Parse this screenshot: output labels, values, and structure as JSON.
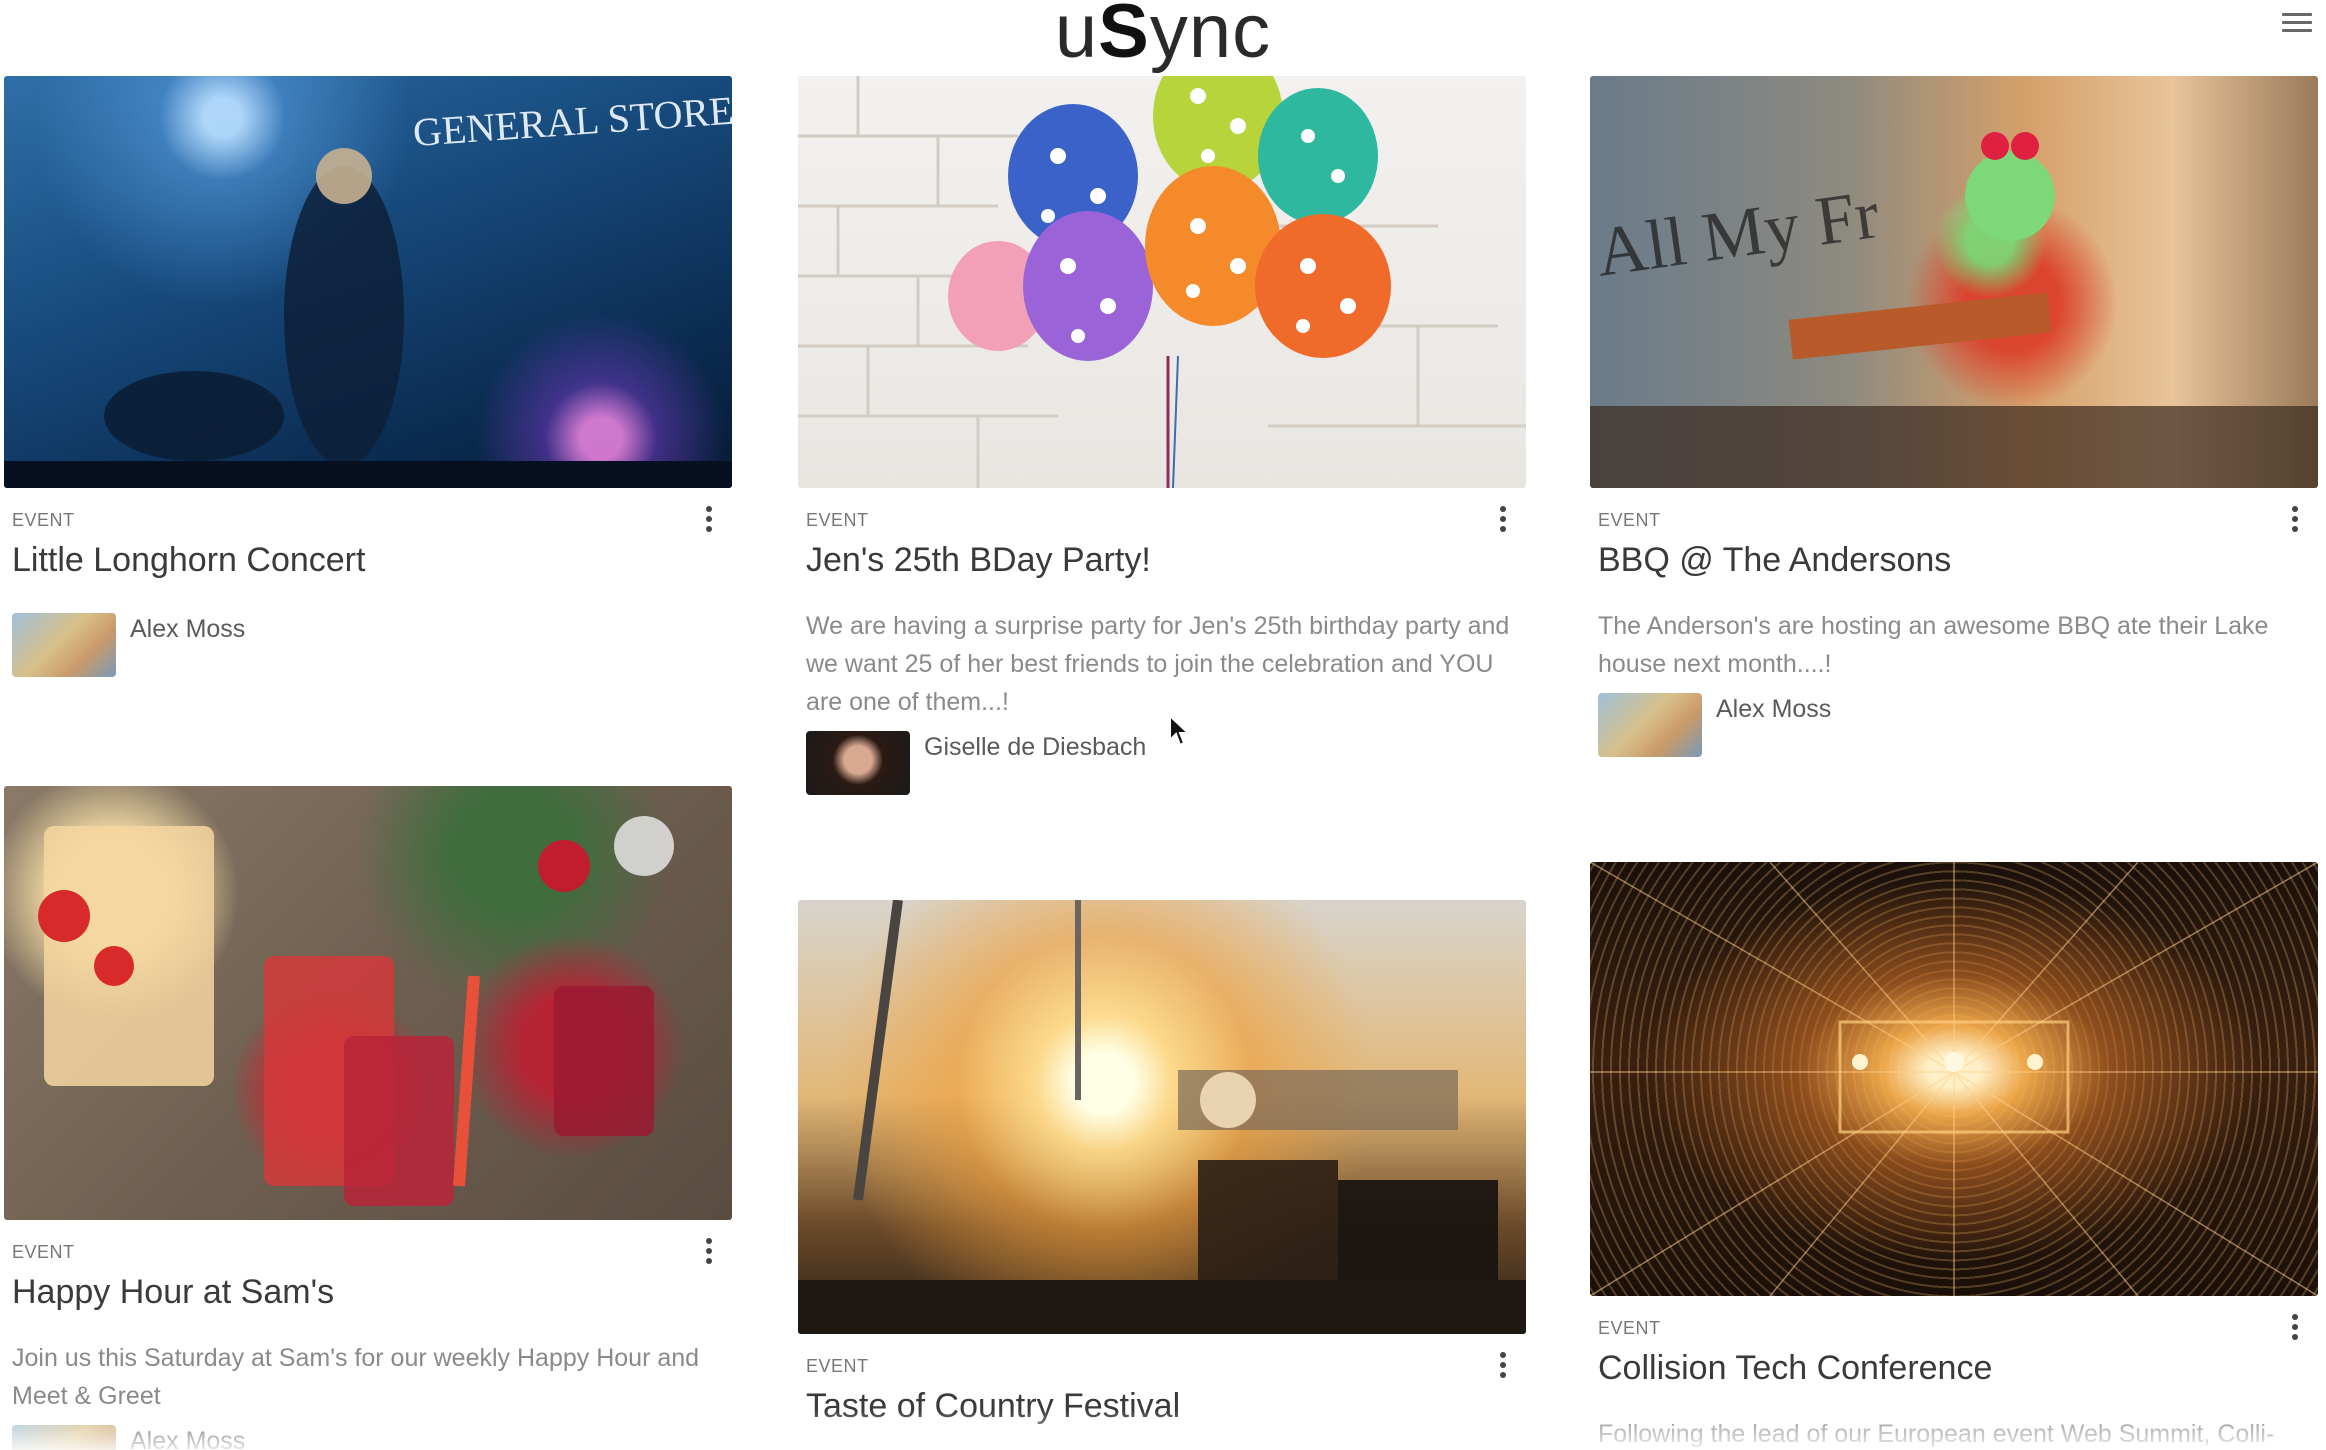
{
  "app": {
    "logo_prefix": "u",
    "logo_big": "S",
    "logo_suffix": "ync",
    "menu_icon": "hamburger-menu-icon"
  },
  "cards": [
    {
      "type": "EVENT",
      "title": "Little Longhorn Concert",
      "description": "",
      "author": "Alex Moss",
      "image": "concert-photo"
    },
    {
      "type": "EVENT",
      "title": "Jen's 25th BDay Party!",
      "description": "We are having a surprise party for Jen's 25th birthday party and we want 25 of her best friends to join the celebration and YOU are one of them...!",
      "author": "Giselle de Diesbach",
      "image": "balloons-photo"
    },
    {
      "type": "EVENT",
      "title": "BBQ @ The Andersons",
      "description": "The Anderson's are hosting an awesome BBQ ate their Lake house next month....!",
      "author": "Alex Moss",
      "image": "keyboard-player-photo"
    },
    {
      "type": "EVENT",
      "title": "Happy Hour at Sam's",
      "description": "Join us this Saturday at Sam's for our weekly Happy Hour and Meet & Greet",
      "author": "Alex Moss",
      "image": "cocktails-photo"
    },
    {
      "type": "EVENT",
      "title": "Taste of Country Festival",
      "description": "",
      "author": "",
      "image": "festival-stage-photo"
    },
    {
      "type": "EVENT",
      "title": "Collision Tech Conference",
      "description": "Following the lead of our European event Web Summit, Colli-",
      "author": "",
      "image": "light-tunnel-photo"
    }
  ]
}
